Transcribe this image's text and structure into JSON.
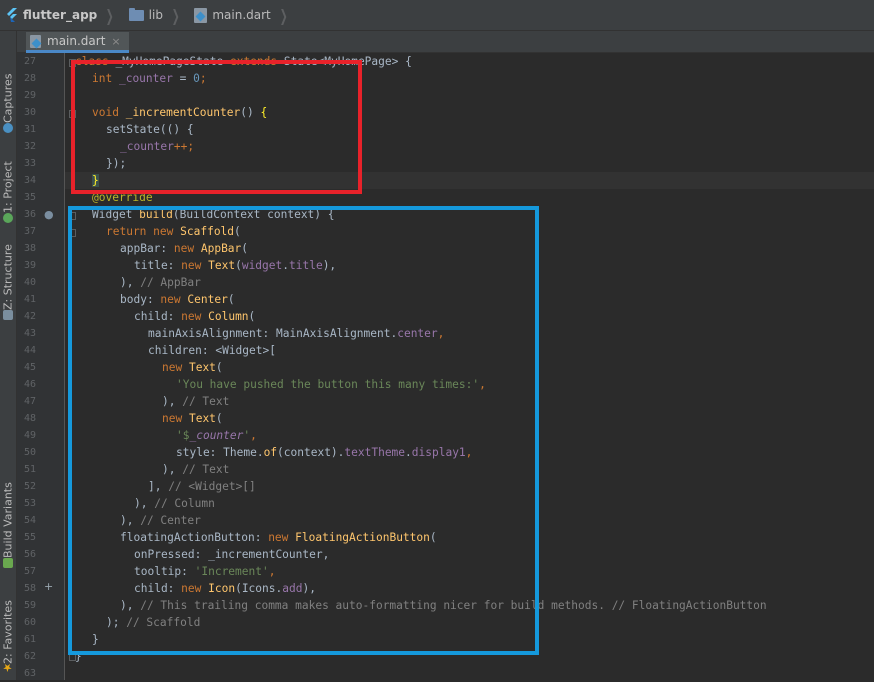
{
  "breadcrumbs": [
    {
      "label": "flutter_app",
      "icon": "flutter-icon"
    },
    {
      "label": "lib",
      "icon": "folder-icon"
    },
    {
      "label": "main.dart",
      "icon": "dart-file-icon"
    }
  ],
  "tabs": [
    {
      "label": "main.dart",
      "close": "×"
    }
  ],
  "toolwindows": {
    "captures": "Captures",
    "project": "1: Project",
    "structure": "Z: Structure",
    "build_variants": "Build Variants",
    "favorites": "2: Favorites"
  },
  "editor": {
    "line_numbers": [
      "27",
      "28",
      "29",
      "30",
      "31",
      "32",
      "33",
      "34",
      "35",
      "36",
      "37",
      "38",
      "39",
      "40",
      "41",
      "42",
      "43",
      "44",
      "45",
      "46",
      "47",
      "48",
      "49",
      "50",
      "51",
      "52",
      "53",
      "54",
      "55",
      "56",
      "57",
      "58",
      "59",
      "60",
      "61",
      "62",
      "63"
    ],
    "code": {
      "l27": [
        "class",
        " ",
        "_MyHomePageState",
        " ",
        "extends",
        " State<MyHomePage> {"
      ],
      "l28": [
        "int",
        " ",
        "_counter",
        " = ",
        "0",
        ";"
      ],
      "l30": [
        "void",
        " ",
        "_incrementCounter",
        "() ",
        "{"
      ],
      "l31": [
        "setState(() {"
      ],
      "l32": [
        "_counter",
        "++;"
      ],
      "l33": [
        "});"
      ],
      "l34": [
        "}"
      ],
      "l35": [
        "@override"
      ],
      "l36": [
        "Widget ",
        "build",
        "(BuildContext context) {"
      ],
      "l37": [
        "return",
        " ",
        "new",
        " ",
        "Scaffold",
        "("
      ],
      "l38": [
        "appBar: ",
        "new",
        " ",
        "AppBar",
        "("
      ],
      "l39": [
        "title: ",
        "new",
        " ",
        "Text",
        "(",
        "widget",
        ".",
        "title",
        "),"
      ],
      "l40": [
        "), ",
        "// AppBar"
      ],
      "l41": [
        "body: ",
        "new",
        " ",
        "Center",
        "("
      ],
      "l42": [
        "child: ",
        "new",
        " ",
        "Column",
        "("
      ],
      "l43": [
        "mainAxisAlignment: MainAxisAlignment.",
        "center",
        ","
      ],
      "l44": [
        "children: <Widget>["
      ],
      "l45": [
        "new",
        " ",
        "Text",
        "("
      ],
      "l46": [
        "'You have pushed the button this many times:'",
        ","
      ],
      "l47": [
        "), ",
        "// Text"
      ],
      "l48": [
        "new",
        " ",
        "Text",
        "("
      ],
      "l49": [
        "'$",
        "_counter",
        "'",
        ","
      ],
      "l50": [
        "style: Theme.",
        "of",
        "(context).",
        "textTheme",
        ".",
        "display1",
        ","
      ],
      "l51": [
        "), ",
        "// Text"
      ],
      "l52": [
        "], ",
        "// <Widget>[]"
      ],
      "l53": [
        "), ",
        "// Column"
      ],
      "l54": [
        "), ",
        "// Center"
      ],
      "l55": [
        "floatingActionButton: ",
        "new",
        " ",
        "FloatingActionButton",
        "("
      ],
      "l56": [
        "onPressed: _incrementCounter,"
      ],
      "l57": [
        "tooltip: ",
        "'Increment'",
        ","
      ],
      "l58": [
        "child: ",
        "new",
        " ",
        "Icon",
        "(Icons.",
        "add",
        "),"
      ],
      "l59": [
        "), ",
        "// This trailing comma makes auto-formatting nicer for build methods. // FloatingActionButton"
      ],
      "l60": [
        "); ",
        "// Scaffold"
      ],
      "l61": [
        "}"
      ],
      "l62": [
        "}"
      ]
    }
  },
  "annotations": {
    "red": "#e8222a",
    "blue": "#1599dc"
  },
  "colors": {
    "keyword": "#cc7832",
    "string": "#6a8759",
    "number": "#6897bb",
    "field": "#9876aa",
    "function": "#ffc66d",
    "comment": "#808080"
  }
}
